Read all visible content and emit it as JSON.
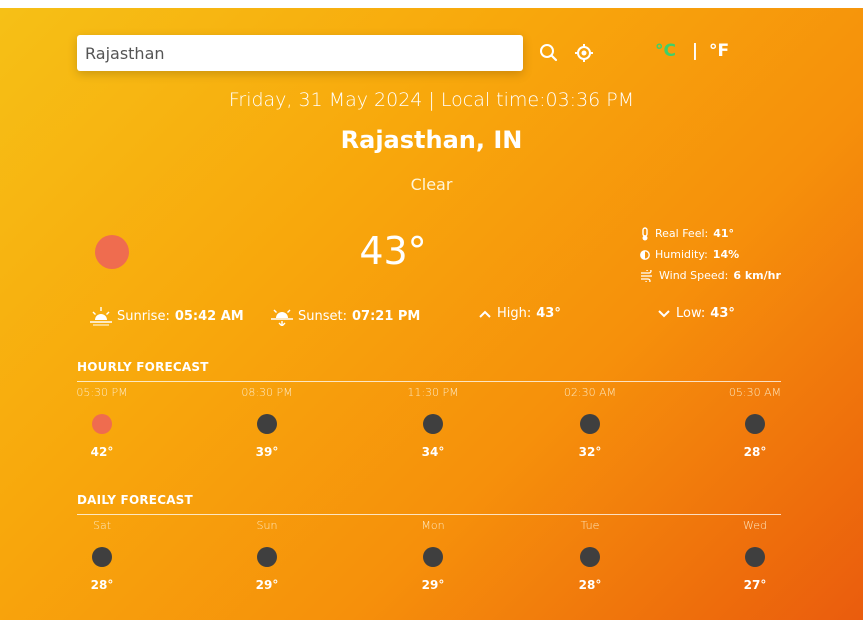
{
  "search": {
    "value": "Rajasthan"
  },
  "icons": {
    "search": "search-icon",
    "location": "crosshair-location-icon"
  },
  "units": {
    "celsius": "°C",
    "separator": "|",
    "fahrenheit": "°F",
    "active_color": "#3fd06a"
  },
  "header": {
    "datetime": "Friday, 31 May 2024 | Local time:03:36 PM",
    "city": "Rajasthan, IN",
    "condition": "Clear"
  },
  "current": {
    "temperature": "43°",
    "icon": "sun-icon",
    "real_feel_label": "Real Feel:",
    "real_feel_value": "41°",
    "humidity_label": "Humidity:",
    "humidity_value": "14%",
    "wind_label": "Wind Speed:",
    "wind_value": "6 km/hr"
  },
  "stats": {
    "sunrise_label": "Sunrise:",
    "sunrise_value": "05:42 AM",
    "sunset_label": "Sunset:",
    "sunset_value": "07:21 PM",
    "high_label": "High:",
    "high_value": "43°",
    "low_label": "Low:",
    "low_value": "43°"
  },
  "hourly": {
    "title": "HOURLY FORECAST",
    "items": [
      {
        "label": "05:30 PM",
        "temp": "42°",
        "icon": "sun"
      },
      {
        "label": "08:30 PM",
        "temp": "39°",
        "icon": "moon"
      },
      {
        "label": "11:30 PM",
        "temp": "34°",
        "icon": "moon"
      },
      {
        "label": "02:30 AM",
        "temp": "32°",
        "icon": "moon"
      },
      {
        "label": "05:30 AM",
        "temp": "28°",
        "icon": "moon"
      }
    ]
  },
  "daily": {
    "title": "DAILY FORECAST",
    "items": [
      {
        "label": "Sat",
        "temp": "28°",
        "icon": "moon"
      },
      {
        "label": "Sun",
        "temp": "29°",
        "icon": "moon"
      },
      {
        "label": "Mon",
        "temp": "29°",
        "icon": "moon"
      },
      {
        "label": "Tue",
        "temp": "28°",
        "icon": "moon"
      },
      {
        "label": "Wed",
        "temp": "27°",
        "icon": "moon"
      }
    ]
  },
  "colors": {
    "sun": "#ef6c4f",
    "night": "#3f3f3f",
    "gradient_start": "#f6c016",
    "gradient_end": "#ea5c0d"
  }
}
